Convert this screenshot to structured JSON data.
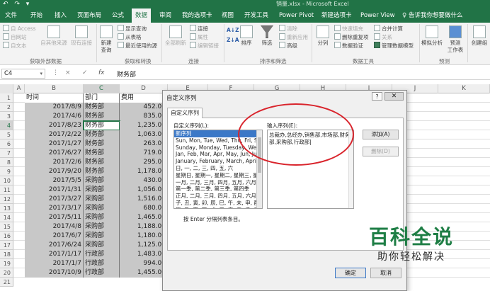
{
  "titlebar": {
    "title": "销量.xlsx - Microsoft Excel",
    "quick_access": "↶ ↷ ▾"
  },
  "tabs": [
    "文件",
    "开始",
    "插入",
    "页面布局",
    "公式",
    "数据",
    "审阅",
    "我的选项卡",
    "视图",
    "开发工具",
    "Power Pivot",
    "新建选项卡",
    "Power View",
    "告诉我你想要做什么"
  ],
  "active_tab": "数据",
  "ribbon": {
    "access": "自 Access",
    "web": "自网站",
    "text": "自文本",
    "other": "自其他来源",
    "existing": "现有连接",
    "new_query": "新建\n查询",
    "show_query": "显示查询",
    "from_table": "从表格",
    "recent": "最近使用的源",
    "refresh_all": "全部刷新",
    "connections": "连接",
    "properties": "属性",
    "edit_links": "编辑链接",
    "sort_az": "A↓Z",
    "sort_za": "Z↓A",
    "sort": "排序",
    "filter": "筛选",
    "clear": "清除",
    "reapply": "重新应用",
    "advanced": "高级",
    "split": "分列",
    "flash_fill": "快速填充",
    "remove_dup": "删除重复项",
    "data_validation": "数据验证",
    "consolidate": "合并计算",
    "relationships": "关系",
    "data_model": "管理数据模型",
    "what_if": "模拟分析",
    "forecast": "预测\n工作表",
    "group": "创建组",
    "groups": {
      "external": "获取外部数据",
      "transform": "获取和转换",
      "connections": "连接",
      "sort_filter": "排序和筛选",
      "data_tools": "数据工具",
      "forecast": "预测"
    }
  },
  "formula_bar": {
    "name_box": "C4",
    "content": "财务部",
    "fx": "fx",
    "cancel": "×",
    "enter": "✓"
  },
  "columns": [
    "A",
    "B",
    "C",
    "D",
    "E",
    "F",
    "G",
    "H",
    "I",
    "J",
    "K"
  ],
  "rows": [
    "1",
    "2",
    "3",
    "4",
    "5",
    "6",
    "7",
    "8",
    "9",
    "10",
    "11",
    "12",
    "13",
    "14",
    "15",
    "16",
    "17",
    "18",
    "19",
    "20",
    "21"
  ],
  "sheet_header": [
    "时间",
    "部门",
    "费用"
  ],
  "sheet_rows": [
    [
      "2017/8/9",
      "财务部",
      "452.00"
    ],
    [
      "2017/4/6",
      "财务部",
      "835.00"
    ],
    [
      "2017/8/23",
      "财务部",
      "1,235.00"
    ],
    [
      "2017/2/22",
      "财务部",
      "1,063.00"
    ],
    [
      "2017/1/27",
      "财务部",
      "263.00"
    ],
    [
      "2017/6/27",
      "财务部",
      "719.00"
    ],
    [
      "2017/2/6",
      "财务部",
      "295.00"
    ],
    [
      "2017/9/20",
      "财务部",
      "1,178.00"
    ],
    [
      "2017/5/5",
      "采购部",
      "430.00"
    ],
    [
      "2017/1/31",
      "采购部",
      "1,056.00"
    ],
    [
      "2017/3/27",
      "采购部",
      "1,516.00"
    ],
    [
      "2017/3/17",
      "采购部",
      "680.00"
    ],
    [
      "2017/5/11",
      "采购部",
      "1,465.00"
    ],
    [
      "2017/4/8",
      "采购部",
      "1,188.00"
    ],
    [
      "2017/6/7",
      "采购部",
      "1,180.00"
    ],
    [
      "2017/6/24",
      "采购部",
      "1,125.00"
    ],
    [
      "2017/1/17",
      "行政部",
      "1,483.00"
    ],
    [
      "2017/1/7",
      "行政部",
      "994.00"
    ],
    [
      "2017/10/9",
      "行政部",
      "1,455.00"
    ]
  ],
  "dialog": {
    "title": "自定义序列",
    "help": "?",
    "close": "✕",
    "tab": "自定义序列",
    "list_label": "自定义序列(L):",
    "entries_label": "输入序列(E):",
    "list_items": [
      "新序列",
      "Sun, Mon, Tue, Wed, Thu, Fri, Sat",
      "Sunday, Monday, Tuesday, Wednesday",
      "Jan, Feb, Mar, Apr, May, Jun, Jul",
      "January, February, March, April",
      "日, 一, 二, 三, 四, 五, 六",
      "星期日, 星期一, 星期二, 星期三, 星期四",
      "一月, 二月, 三月, 四月, 五月, 六月",
      "第一季, 第二季, 第三季, 第四季",
      "正月, 二月, 三月, 四月, 五月, 六月",
      "子, 丑, 寅, 卯, 辰, 巳, 午, 未, 申, 酉",
      "甲, 乙, 丙, 丁, 戊, 己, 庚, 辛, 壬, 癸"
    ],
    "entries_text": "总裁办,总经办,销售部,市场部,财务部,采购部,行政部",
    "add": "添加(A)",
    "delete": "删除(D)",
    "hint": "按 Enter 分隔列表条目。",
    "ok": "确定",
    "cancel": "取消"
  },
  "watermark": {
    "main": "百科全说",
    "sub": "助你轻松解决"
  },
  "colors": {
    "excel_green": "#217346",
    "annotation_red": "#d9242c",
    "selection_blue": "#3b78c7",
    "watermark_green": "#1e7e45"
  }
}
